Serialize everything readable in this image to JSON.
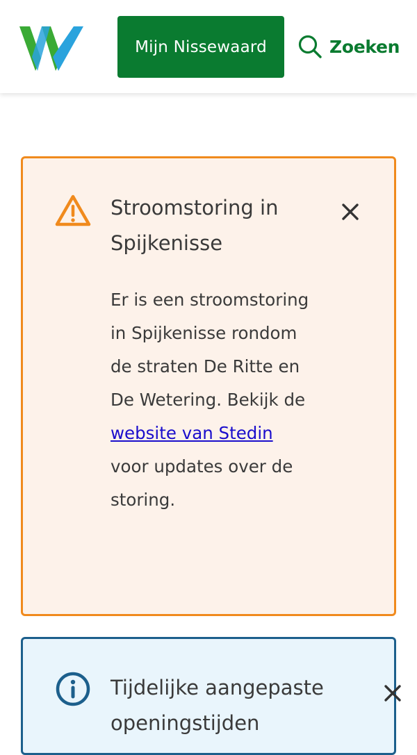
{
  "header": {
    "mijn_label": "Mijn Nissewaard",
    "search_label": "Zoeken"
  },
  "colors": {
    "brand_green": "#0a7b30",
    "logo_green": "#3aaa35",
    "logo_blue": "#2aa3dd",
    "warning_border": "#f08a1d",
    "warning_bg": "#fdf2ea",
    "info_border": "#1c5f8c",
    "info_bg": "#e9f5fc",
    "link": "#1a0dcc"
  },
  "icons": {
    "logo": "nissewaard-w-logo",
    "search": "search-icon",
    "warning": "warning-triangle-icon",
    "info": "info-circle-icon",
    "close": "close-icon"
  },
  "alerts": [
    {
      "type": "warning",
      "title": "Stroomstoring in Spijkenisse",
      "body_before": "Er is een stroomstoring in Spijkenisse rondom de straten De Ritte en De Wetering. Bekijk de ",
      "link_text": "website van Stedin",
      "body_after": " voor updates over de storing."
    },
    {
      "type": "info",
      "title": "Tijdelijke aangepaste openingstijden"
    }
  ]
}
